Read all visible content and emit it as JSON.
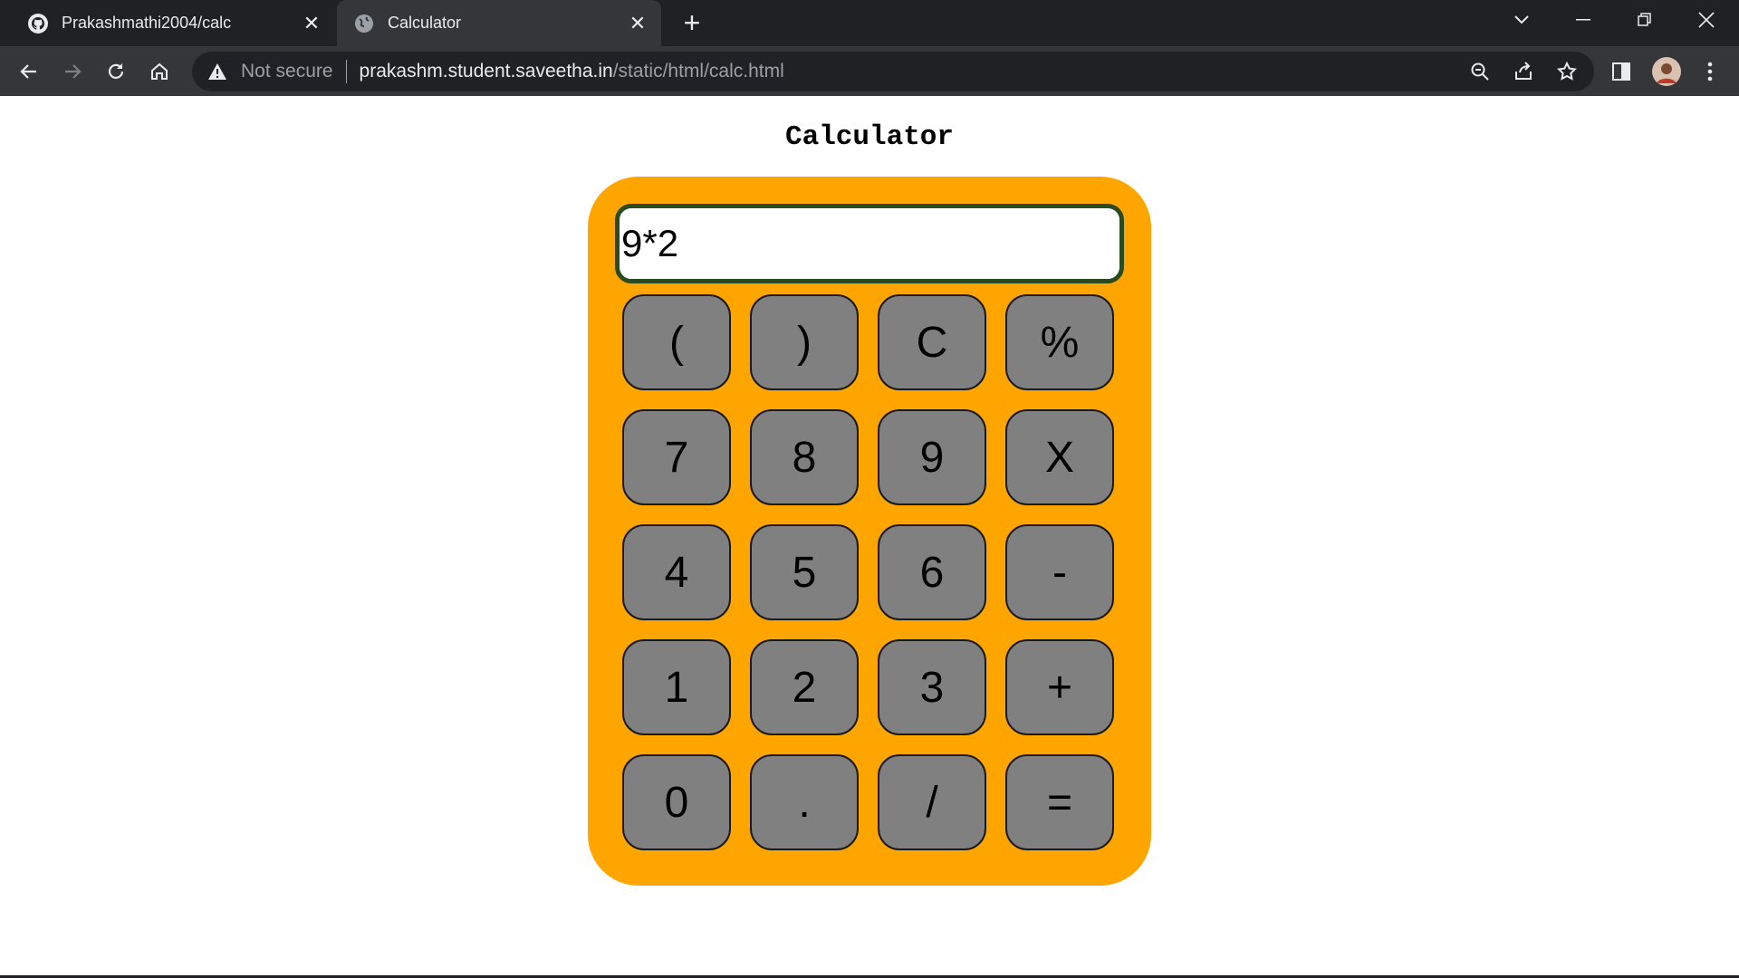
{
  "browser": {
    "tabs": [
      {
        "title": "Prakashmathi2004/calc",
        "icon": "github-icon",
        "active": false
      },
      {
        "title": "Calculator",
        "icon": "globe-icon",
        "active": true
      }
    ],
    "address": {
      "security_label": "Not secure",
      "host": "prakashm.student.saveetha.in",
      "path": "/static/html/calc.html"
    }
  },
  "page": {
    "title": "Calculator"
  },
  "calculator": {
    "display_value": "9*2",
    "colors": {
      "body": "#ffa500",
      "key": "#808080",
      "display_border": "#2a4a1f"
    },
    "keys": [
      [
        "(",
        ")",
        "C",
        "%"
      ],
      [
        "7",
        "8",
        "9",
        "X"
      ],
      [
        "4",
        "5",
        "6",
        "-"
      ],
      [
        "1",
        "2",
        "3",
        "+"
      ],
      [
        "0",
        ".",
        "/",
        "="
      ]
    ]
  }
}
